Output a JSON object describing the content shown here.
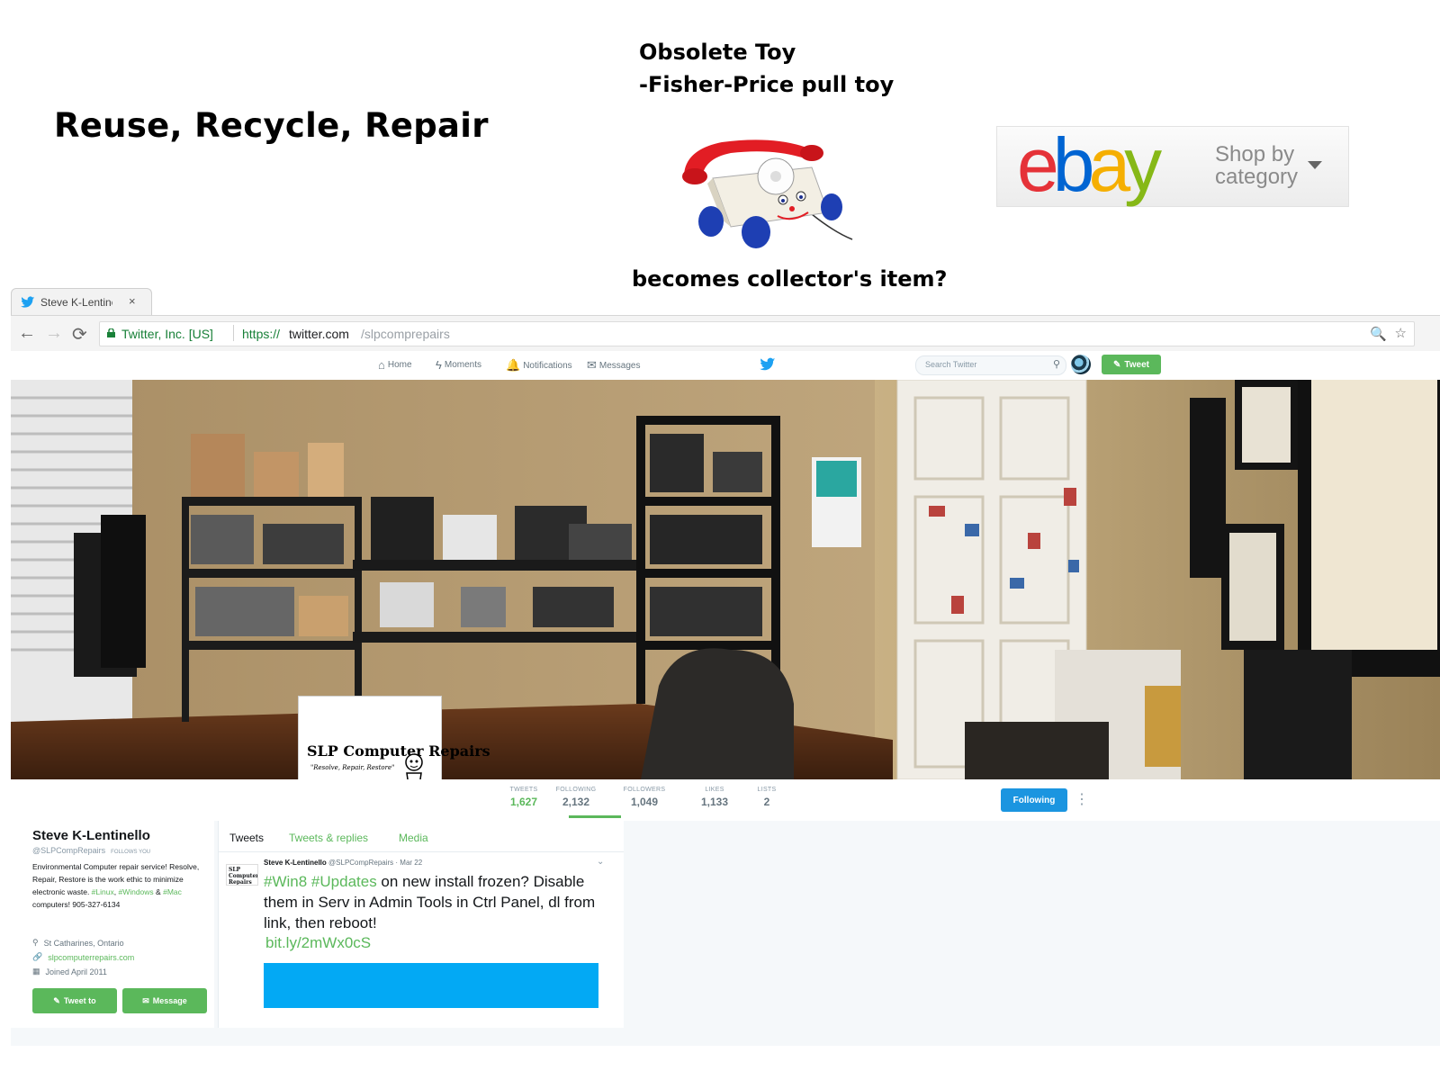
{
  "slide": {
    "title": "Reuse, Recycle, Repair",
    "toy_line1": "Obsolete Toy",
    "toy_line2": "-Fisher-Price pull toy",
    "toy_bottom": "becomes collector's item?"
  },
  "ebay": {
    "logo_letters": [
      "e",
      "b",
      "a",
      "y"
    ],
    "logo_colors": [
      "#e53238",
      "#0064d2",
      "#f5af02",
      "#86b817"
    ],
    "shop_line1": "Shop by",
    "shop_line2": "category"
  },
  "browser": {
    "tab_title": "Steve K-Lentinello",
    "tab_close": "×",
    "secure_org": "Twitter, Inc. [US]",
    "url_scheme": "https://",
    "url_host": "twitter.com",
    "url_path": "/slpcomprepairs",
    "back": "←",
    "forward": "→",
    "reload": "⟳",
    "zoom": "🔍",
    "star": "☆"
  },
  "twitter_nav": {
    "items": [
      {
        "icon": "⌂",
        "label": "Home"
      },
      {
        "icon": "ϟ",
        "label": "Moments"
      },
      {
        "icon": "🔔",
        "label": "Notifications"
      },
      {
        "icon": "✉",
        "label": "Messages"
      }
    ],
    "search_placeholder": "Search Twitter",
    "search_icon": "⚲",
    "tweet_button": "Tweet",
    "accent": "#5bb85b"
  },
  "profile_card": {
    "name": "SLP Computer Repairs",
    "tagline": "\"Resolve, Repair, Restore\""
  },
  "stats": [
    {
      "label": "Tweets",
      "value": "1,627",
      "active": true
    },
    {
      "label": "Following",
      "value": "2,132",
      "active": false
    },
    {
      "label": "Followers",
      "value": "1,049",
      "active": false
    },
    {
      "label": "Likes",
      "value": "1,133",
      "active": false
    },
    {
      "label": "Lists",
      "value": "2",
      "active": false
    }
  ],
  "following_button": "Following",
  "profile": {
    "name": "Steve K-Lentinello",
    "handle": "@SLPCompRepairs",
    "follows_you": "Follows you",
    "bio_1": "Environmental Computer repair service! Resolve, Repair, Restore is the work ethic to minimize electronic waste. ",
    "bio_linux": "#Linux",
    "bio_2": ", ",
    "bio_windows": "#Windows",
    "bio_3": " & ",
    "bio_mac": "#Mac",
    "bio_4": " computers! 905-327-6134",
    "location": "St Catharines, Ontario",
    "website": "slpcomputerrepairs.com",
    "joined": "Joined April 2011",
    "tweet_to": "Tweet to",
    "message": "Message"
  },
  "tweets_tabs": [
    "Tweets",
    "Tweets & replies",
    "Media"
  ],
  "tweet": {
    "avatar_text": "SLP Computer Repairs",
    "author": "Steve K-Lentinello",
    "handle": "@SLPCompRepairs",
    "date": "· Mar 22",
    "tag1": "#Win8",
    "tag2": "#Updates",
    "text": " on new install frozen? Disable them in Serv in Admin Tools in Ctrl Panel, dl from link, then reboot!",
    "link": "bit.ly/2mWx0cS",
    "card_color": "#03a9f4"
  }
}
